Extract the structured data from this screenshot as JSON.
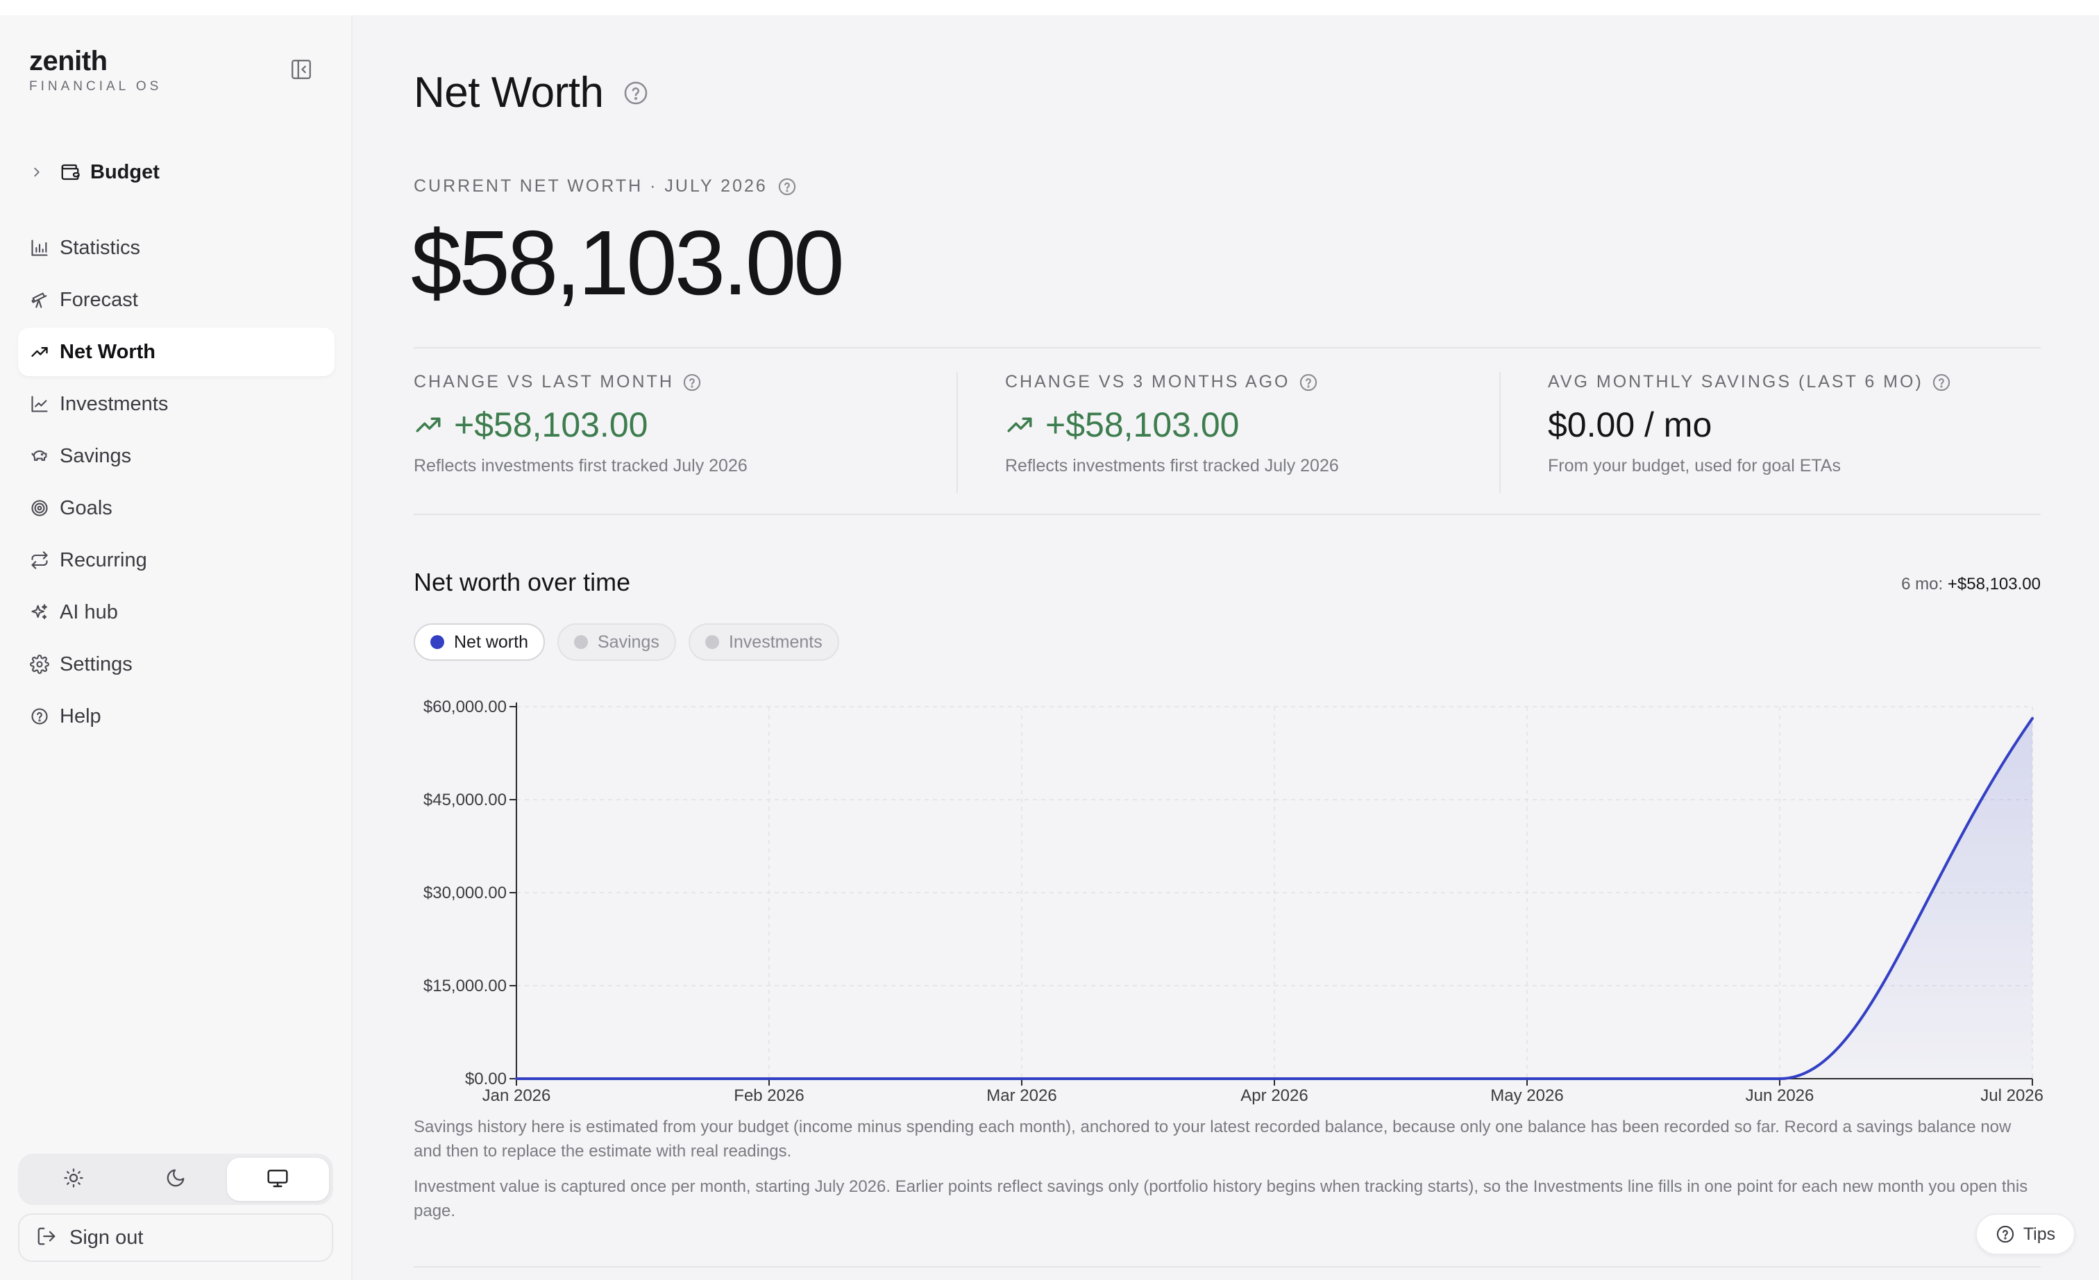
{
  "app": {
    "name": "zenith",
    "subtitle": "FINANCIAL OS"
  },
  "sidebar": {
    "budget": {
      "label": "Budget",
      "icon": "wallet-icon"
    },
    "items": [
      {
        "label": "Statistics",
        "icon": "bar-chart-icon",
        "active": false
      },
      {
        "label": "Forecast",
        "icon": "telescope-icon",
        "active": false
      },
      {
        "label": "Net Worth",
        "icon": "trending-up-icon",
        "active": true
      },
      {
        "label": "Investments",
        "icon": "line-chart-icon",
        "active": false
      },
      {
        "label": "Savings",
        "icon": "piggy-bank-icon",
        "active": false
      },
      {
        "label": "Goals",
        "icon": "target-icon",
        "active": false
      },
      {
        "label": "Recurring",
        "icon": "repeat-icon",
        "active": false
      },
      {
        "label": "AI hub",
        "icon": "sparkles-icon",
        "active": false
      },
      {
        "label": "Settings",
        "icon": "gear-icon",
        "active": false
      },
      {
        "label": "Help",
        "icon": "help-circle-icon",
        "active": false
      }
    ],
    "theme": {
      "options": [
        "light",
        "dark",
        "system"
      ],
      "selected": "system"
    },
    "signout_label": "Sign out"
  },
  "page": {
    "title": "Net Worth",
    "current": {
      "label": "CURRENT NET WORTH · JULY 2026",
      "value": "$58,103.00"
    },
    "stats": [
      {
        "label": "CHANGE VS LAST MONTH",
        "value": "+$58,103.00",
        "note": "Reflects investments first tracked July 2026",
        "trend": "up"
      },
      {
        "label": "CHANGE VS 3 MONTHS AGO",
        "value": "+$58,103.00",
        "note": "Reflects investments first tracked July 2026",
        "trend": "up"
      },
      {
        "label": "AVG MONTHLY SAVINGS (LAST 6 MO)",
        "value": "$0.00 / mo",
        "note": "From your budget, used for goal ETAs",
        "trend": "none"
      }
    ],
    "chart_section": {
      "title": "Net worth over time",
      "delta_label": "6 mo:",
      "delta_value": "+$58,103.00",
      "pills": [
        {
          "label": "Net worth",
          "active": true
        },
        {
          "label": "Savings",
          "active": false
        },
        {
          "label": "Investments",
          "active": false
        }
      ]
    },
    "footnotes": [
      "Savings history here is estimated from your budget (income minus spending each month), anchored to your latest recorded balance, because only one balance has been recorded so far. Record a savings balance now and then to replace the estimate with real readings.",
      "Investment value is captured once per month, starting July 2026. Earlier points reflect savings only (portfolio history begins when tracking starts), so the Investments line fills in one point for each new month you open this page."
    ],
    "tips_label": "Tips"
  },
  "colors": {
    "accent": "#3340c4",
    "positive": "#3d7d4e"
  },
  "chart_data": {
    "type": "area",
    "categories": [
      "Jan 2026",
      "Feb 2026",
      "Mar 2026",
      "Apr 2026",
      "May 2026",
      "Jun 2026",
      "Jul 2026"
    ],
    "series": [
      {
        "name": "Net worth",
        "values": [
          0,
          0,
          0,
          0,
          0,
          0,
          58103
        ]
      }
    ],
    "y_ticks": [
      "$0.00",
      "$15,000.00",
      "$30,000.00",
      "$45,000.00",
      "$60,000.00"
    ],
    "ylim": [
      0,
      60000
    ],
    "grid": true,
    "curve": "smooth"
  }
}
